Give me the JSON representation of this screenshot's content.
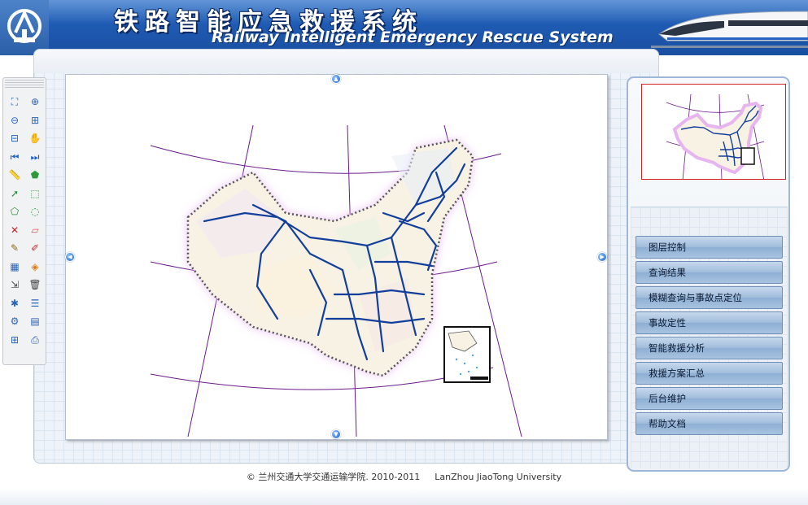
{
  "header": {
    "title_cn": "铁路智能应急救援系统",
    "title_en": "Railway Intelligent Emergency Rescue System",
    "logo_icon": "railway-logo-icon",
    "train_image": "high-speed-train-image"
  },
  "toolbar": {
    "tools": [
      {
        "name": "full-extent-icon",
        "glyph": "⛶",
        "color": "#2a63b8"
      },
      {
        "name": "zoom-in-icon",
        "glyph": "⊕",
        "color": "#2a63b8"
      },
      {
        "name": "zoom-out-icon",
        "glyph": "⊖",
        "color": "#2a63b8"
      },
      {
        "name": "zoom-in-box-icon",
        "glyph": "⊞",
        "color": "#2a63b8"
      },
      {
        "name": "zoom-out-box-icon",
        "glyph": "⊟",
        "color": "#2a63b8"
      },
      {
        "name": "pan-hand-icon",
        "glyph": "✋",
        "color": "#3a6fb5"
      },
      {
        "name": "previous-extent-icon",
        "glyph": "⏮",
        "color": "#1a5fd0"
      },
      {
        "name": "next-extent-icon",
        "glyph": "⏭",
        "color": "#1a5fd0"
      },
      {
        "name": "measure-distance-icon",
        "glyph": "📏",
        "color": "#c2902a"
      },
      {
        "name": "measure-area-icon",
        "glyph": "⬟",
        "color": "#2e9a3e"
      },
      {
        "name": "select-feature-icon",
        "glyph": "➚",
        "color": "#2d8b3a"
      },
      {
        "name": "select-box-icon",
        "glyph": "⬚",
        "color": "#2d8b3a"
      },
      {
        "name": "select-polygon-icon",
        "glyph": "⬠",
        "color": "#2d8b3a"
      },
      {
        "name": "select-circle-icon",
        "glyph": "◌",
        "color": "#2d8b3a"
      },
      {
        "name": "clear-selection-icon",
        "glyph": "✕",
        "color": "#d21e1e"
      },
      {
        "name": "eraser-icon",
        "glyph": "▱",
        "color": "#d25a5a"
      },
      {
        "name": "draw-line-icon",
        "glyph": "✎",
        "color": "#8a6a1a"
      },
      {
        "name": "draw-pen-icon",
        "glyph": "✐",
        "color": "#c23030"
      },
      {
        "name": "edit-layer-icon",
        "glyph": "▦",
        "color": "#2a63b8"
      },
      {
        "name": "layer-colors-icon",
        "glyph": "◈",
        "color": "#e07a12"
      },
      {
        "name": "move-feature-icon",
        "glyph": "⇲",
        "color": "#444444"
      },
      {
        "name": "delete-trash-icon",
        "glyph": "🗑",
        "color": "#444444"
      },
      {
        "name": "network-analysis-icon",
        "glyph": "✱",
        "color": "#2a63b8"
      },
      {
        "name": "attribute-table-icon",
        "glyph": "☰",
        "color": "#2a63b8"
      },
      {
        "name": "identify-settings-icon",
        "glyph": "⚙",
        "color": "#2a63b8"
      },
      {
        "name": "data-grid-icon",
        "glyph": "▤",
        "color": "#2a63b8"
      },
      {
        "name": "export-table-icon",
        "glyph": "⊞",
        "color": "#2a63b8"
      },
      {
        "name": "print-report-icon",
        "glyph": "⎙",
        "color": "#2a63b8"
      }
    ]
  },
  "map": {
    "pan_up_icon": "pan-up-icon",
    "pan_down_icon": "pan-down-icon",
    "pan_left_icon": "pan-left-icon",
    "pan_right_icon": "pan-right-icon",
    "railway_color": "#123f9c",
    "graticule_color": "#6b1a8c",
    "border_glow_color": "#e6b5ef"
  },
  "menu": {
    "items": [
      {
        "label": "图层控制"
      },
      {
        "label": "查询结果"
      },
      {
        "label": "模糊查询与事故点定位"
      },
      {
        "label": "事故定性"
      },
      {
        "label": "智能救援分析"
      },
      {
        "label": "救援方案汇总"
      },
      {
        "label": "后台维护"
      },
      {
        "label": "帮助文档"
      }
    ]
  },
  "footer": {
    "copyright": "© 兰州交通大学交通运输学院. 2010-2011",
    "university": "LanZhou JiaoTong University"
  }
}
